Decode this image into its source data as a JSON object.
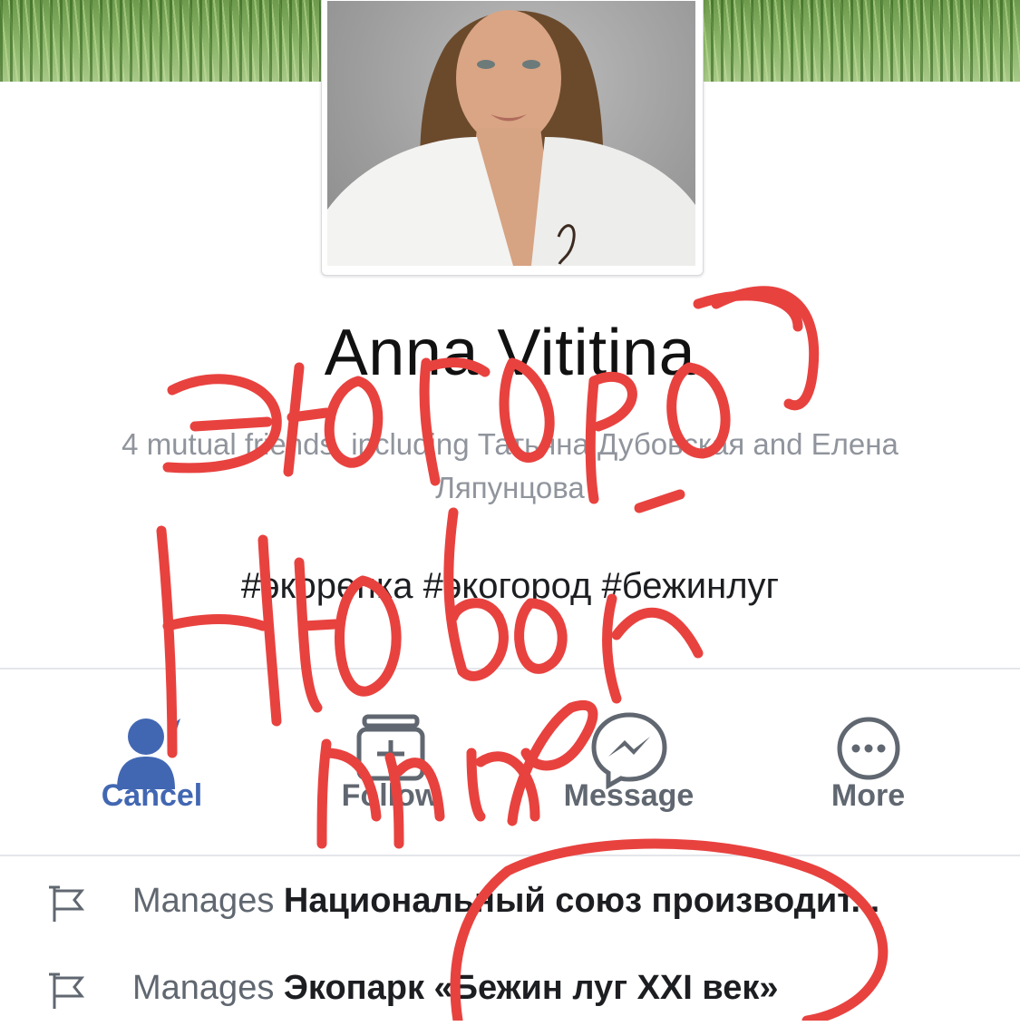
{
  "profile": {
    "name": "Anna Vititina",
    "mutual_prefix": "4 mutual friends, including ",
    "mutual_friend_1": "Татьяна Дубовская",
    "mutual_joiner": " and ",
    "mutual_friend_2": "Елена Ляпунцова",
    "tags": "#экорепка #экогород #бежинлуг"
  },
  "actions": {
    "cancel": "Cancel",
    "follow": "Follow",
    "message": "Message",
    "more": "More"
  },
  "manages": [
    {
      "prefix": "Manages ",
      "page": "Национальный союз производит..."
    },
    {
      "prefix": "Manages ",
      "page": "Экопарк «Бежин луг XXI век»"
    }
  ],
  "colors": {
    "accent": "#4267b2",
    "secondary_text": "#90949c",
    "annotation_red": "#e8423f"
  },
  "icons": {
    "cancel": "person-icon",
    "follow": "follow-icon",
    "message": "messenger-icon",
    "more": "more-icon",
    "row": "flag-icon"
  }
}
